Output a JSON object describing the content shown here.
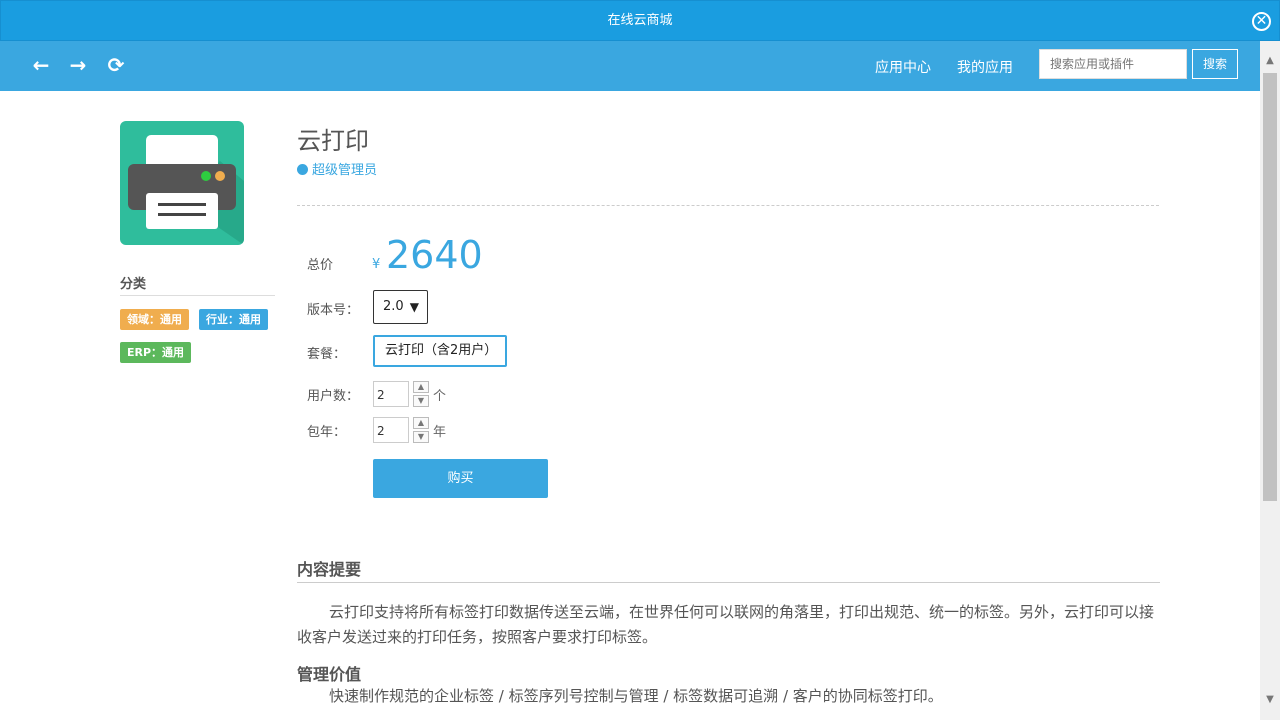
{
  "window": {
    "title": "在线云商城",
    "close_icon": "close-circle-icon"
  },
  "navbar": {
    "back_icon": "arrow-left-icon",
    "forward_icon": "arrow-right-icon",
    "refresh_icon": "refresh-icon",
    "links": [
      "应用中心",
      "我的应用"
    ],
    "search_placeholder": "搜索应用或插件",
    "search_button": "搜索"
  },
  "sidebar": {
    "category_title": "分类",
    "tags": [
      {
        "label": "领域：通用",
        "color": "#f0ad4e"
      },
      {
        "label": "行业：通用",
        "color": "#3aa7e0"
      },
      {
        "label": "ERP：通用",
        "color": "#5cb85c"
      }
    ]
  },
  "app": {
    "icon": "printer-icon",
    "title": "云打印",
    "author": "超级管理员",
    "author_icon": "globe-icon"
  },
  "purchase": {
    "price_label": "总价",
    "currency": "¥",
    "price": "2640",
    "version_label": "版本号：",
    "version_value": "2.0",
    "plan_label": "套餐：",
    "plan_value": "云打印（含2用户）",
    "users_label": "用户数：",
    "users_value": "2",
    "users_unit": "个",
    "years_label": "包年：",
    "years_value": "2",
    "years_unit": "年",
    "buy_button": "购买"
  },
  "content": {
    "summary_title": "内容提要",
    "summary_text": "云打印支持将所有标签打印数据传送至云端，在世界任何可以联网的角落里，打印出规范、统一的标签。另外，云打印可以接收客户发送过来的打印任务，按照客户要求打印标签。",
    "value_title": "管理价值",
    "value_text": "快速制作规范的企业标签 / 标签序列号控制与管理 / 标签数据可追溯 / 客户的协同标签打印。"
  },
  "colors": {
    "titlebar": "#1a9de0",
    "navbar": "#3aa7e0",
    "accent": "#3aa7e0",
    "icon_bg": "#2fbd9c"
  }
}
